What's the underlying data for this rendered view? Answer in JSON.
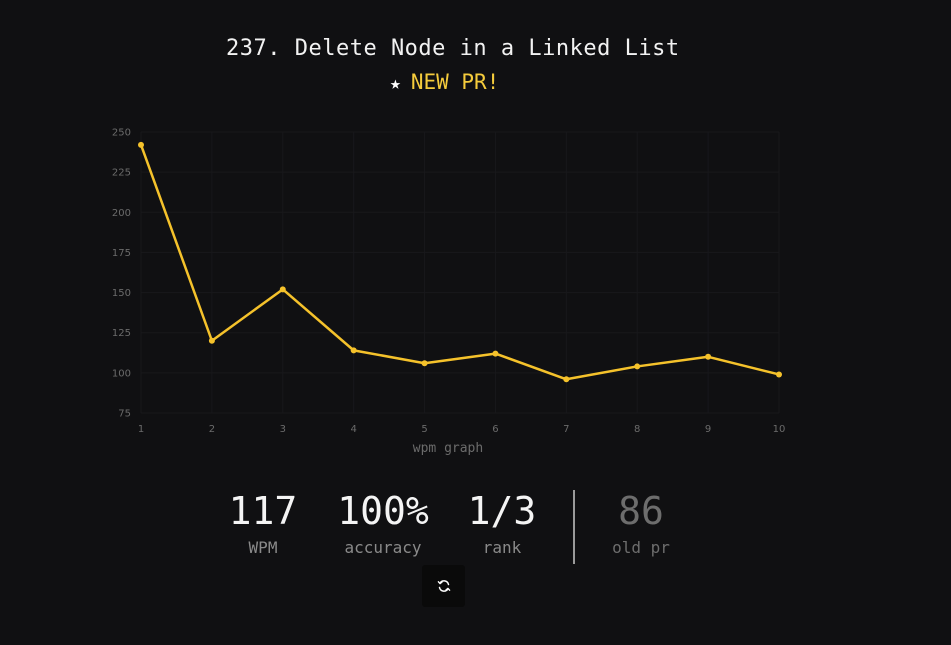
{
  "header": {
    "title": "237. Delete Node in a Linked List",
    "pr_star": "★",
    "pr_text": "NEW PR!"
  },
  "chart_data": {
    "type": "line",
    "xlabel": "wpm graph",
    "x": [
      1,
      2,
      3,
      4,
      5,
      6,
      7,
      8,
      9,
      10
    ],
    "series": [
      {
        "values": [
          242,
          120,
          152,
          114,
          106,
          112,
          96,
          104,
          110,
          99
        ]
      }
    ],
    "ylim": [
      75,
      250
    ],
    "yticks": [
      75,
      100,
      125,
      150,
      175,
      200,
      225,
      250
    ],
    "grid": true,
    "color": "#f5c22b"
  },
  "stats": [
    {
      "value": "117",
      "label": "WPM"
    },
    {
      "value": "100%",
      "label": "accuracy"
    },
    {
      "value": "1/3",
      "label": "rank"
    },
    {
      "value": "86",
      "label": "old pr"
    }
  ],
  "controls": {
    "restart_icon": "refresh-icon"
  }
}
